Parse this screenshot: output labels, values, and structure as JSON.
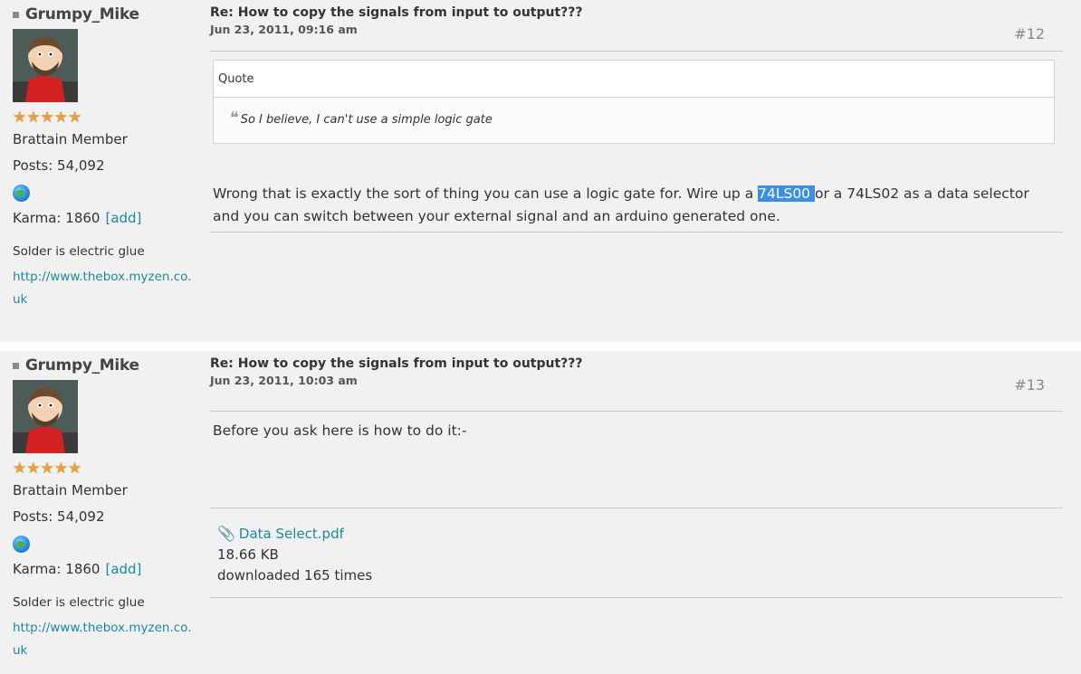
{
  "posts": [
    {
      "author": "Grumpy_Mike",
      "stars": "★★★★★",
      "rank": "Brattain Member",
      "posts": "Posts: 54,092",
      "karma": "Karma: 1860",
      "karma_add": "[add]",
      "signature": "Solder is electric glue",
      "signature_link": "http://www.thebox.myzen.co.uk",
      "subject": "Re: How to copy the signals from input to output???",
      "date": "Jun 23, 2011, 09:16 am",
      "number": "#12",
      "quote_label": "Quote",
      "quote_text": "So I believe, I can't use a simple logic gate",
      "body_before": "Wrong that is exactly the sort of thing you can use a logic gate for. Wire up a ",
      "body_highlight": "74LS00 ",
      "body_after": "or a 74LS02 as a data selector and you can switch between your external signal and an arduino generated one."
    },
    {
      "author": "Grumpy_Mike",
      "stars": "★★★★★",
      "rank": "Brattain Member",
      "posts": "Posts: 54,092",
      "karma": "Karma: 1860",
      "karma_add": "[add]",
      "signature": "Solder is electric glue",
      "signature_link": "http://www.thebox.myzen.co.uk",
      "subject": "Re: How to copy the signals from input to output???",
      "date": "Jun 23, 2011, 10:03 am",
      "number": "#13",
      "body": "Before you ask here is how to do it:-",
      "attachment": {
        "name": "Data Select.pdf",
        "size": "18.66 KB",
        "downloads": "downloaded 165 times"
      }
    }
  ],
  "colors": {
    "link": "#1a8a9c",
    "highlight": "#3a8ee6",
    "panel": "#f1f1f1"
  },
  "icons": [
    "status-square-icon",
    "rank-star-icon",
    "globe-icon",
    "quote-mark-icon",
    "paperclip-icon"
  ]
}
